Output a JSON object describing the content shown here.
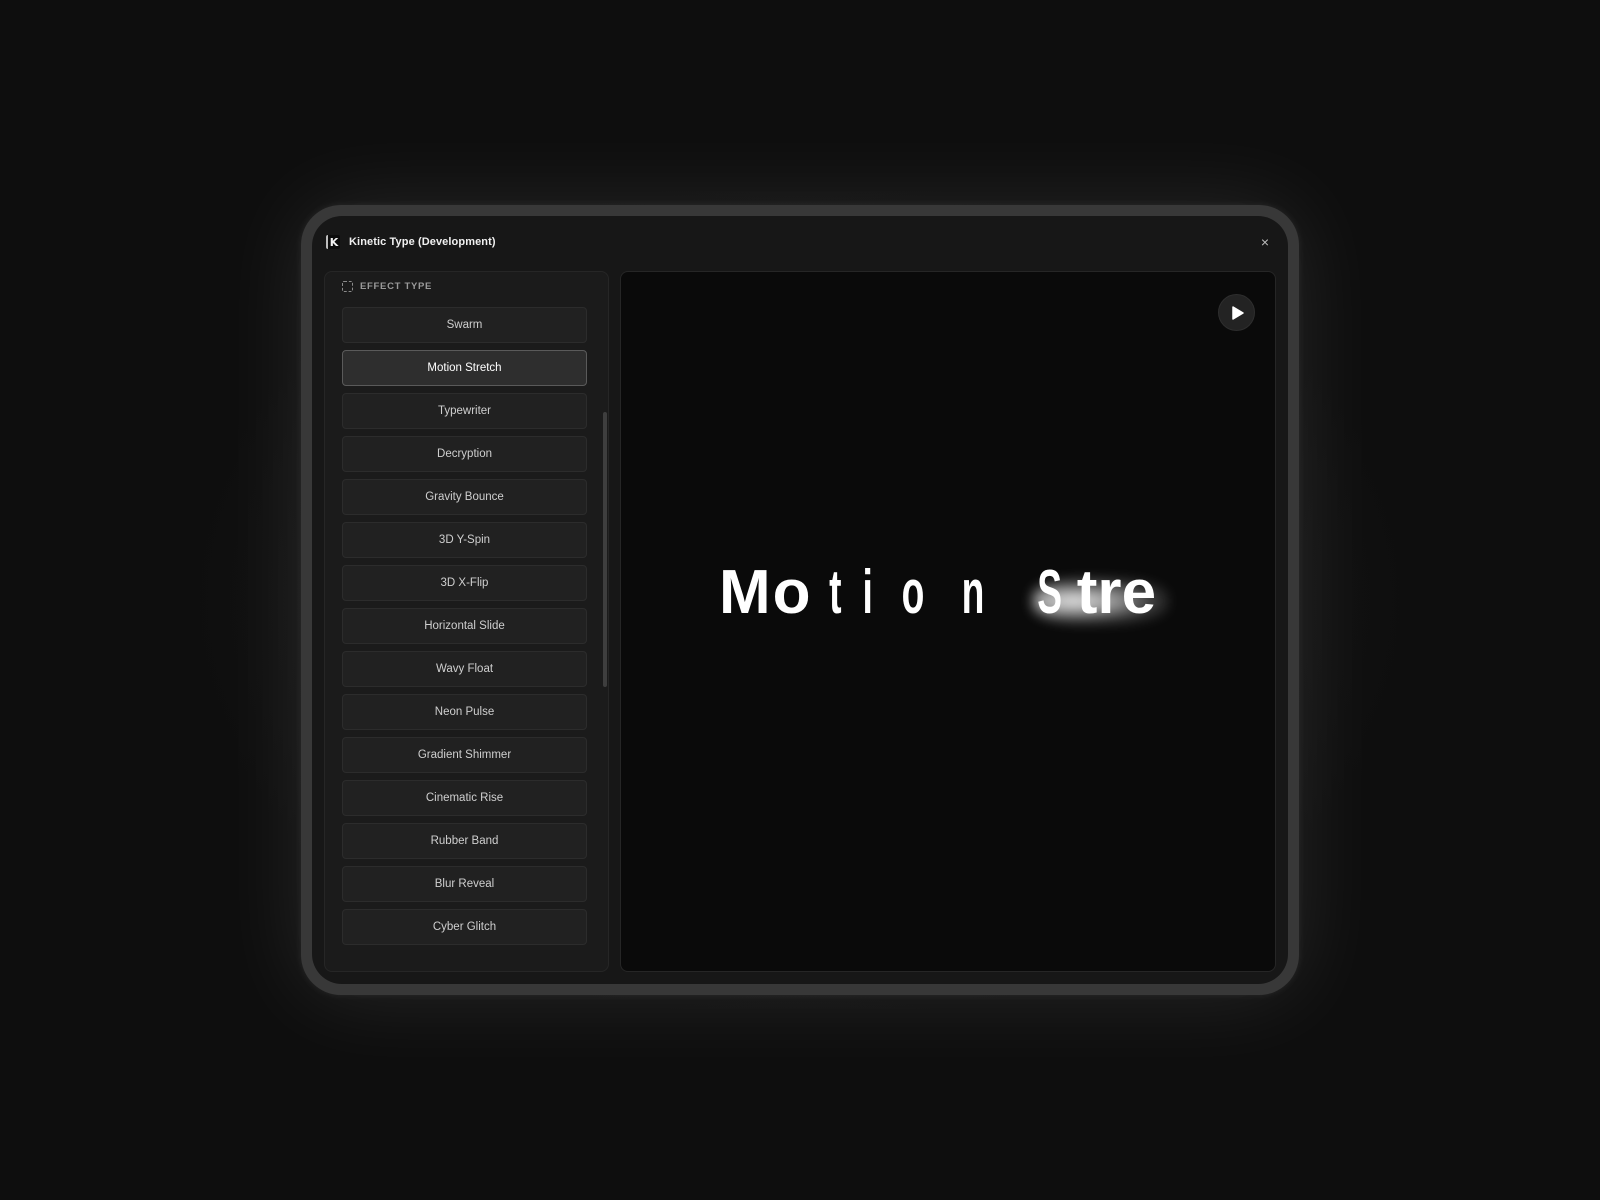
{
  "window": {
    "title": "Kinetic Type (Development)",
    "logo_letter": "K",
    "close_glyph": "×"
  },
  "sidebar": {
    "section_label": "EFFECT TYPE",
    "section_icon": "dashed-square-icon",
    "selected": "Motion Stretch",
    "effects": [
      {
        "label": "Swarm"
      },
      {
        "label": "Motion Stretch",
        "active": true
      },
      {
        "label": "Typewriter"
      },
      {
        "label": "Decryption"
      },
      {
        "label": "Gravity Bounce"
      },
      {
        "label": "3D Y-Spin"
      },
      {
        "label": "3D X-Flip"
      },
      {
        "label": "Horizontal Slide"
      },
      {
        "label": "Wavy Float"
      },
      {
        "label": "Neon Pulse"
      },
      {
        "label": "Gradient Shimmer"
      },
      {
        "label": "Cinematic Rise"
      },
      {
        "label": "Rubber Band"
      },
      {
        "label": "Blur Reveal"
      },
      {
        "label": "Cyber Glitch"
      }
    ]
  },
  "preview": {
    "play_icon": "play-icon",
    "glyphs": [
      "M",
      "o",
      "t",
      "i",
      "o",
      "n",
      " ",
      "S",
      "t",
      "r",
      "e"
    ]
  },
  "colors": {
    "background": "#141414",
    "frame": "#383838",
    "window": "#171717",
    "preview_bg": "#0a0a0a",
    "active_border": "#5a5a5a",
    "text": "#ffffff"
  }
}
